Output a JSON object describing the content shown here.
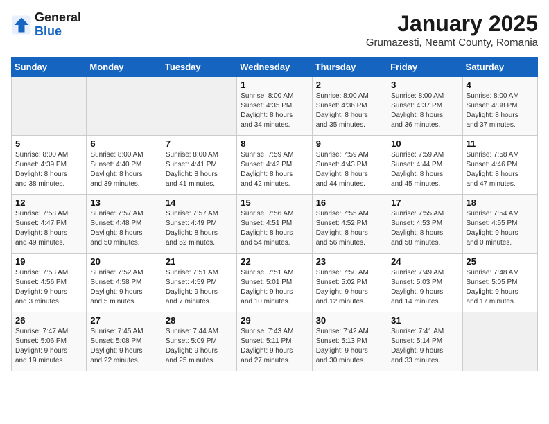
{
  "header": {
    "logo_general": "General",
    "logo_blue": "Blue",
    "month": "January 2025",
    "location": "Grumazesti, Neamt County, Romania"
  },
  "weekdays": [
    "Sunday",
    "Monday",
    "Tuesday",
    "Wednesday",
    "Thursday",
    "Friday",
    "Saturday"
  ],
  "weeks": [
    [
      {
        "day": "",
        "info": ""
      },
      {
        "day": "",
        "info": ""
      },
      {
        "day": "",
        "info": ""
      },
      {
        "day": "1",
        "info": "Sunrise: 8:00 AM\nSunset: 4:35 PM\nDaylight: 8 hours\nand 34 minutes."
      },
      {
        "day": "2",
        "info": "Sunrise: 8:00 AM\nSunset: 4:36 PM\nDaylight: 8 hours\nand 35 minutes."
      },
      {
        "day": "3",
        "info": "Sunrise: 8:00 AM\nSunset: 4:37 PM\nDaylight: 8 hours\nand 36 minutes."
      },
      {
        "day": "4",
        "info": "Sunrise: 8:00 AM\nSunset: 4:38 PM\nDaylight: 8 hours\nand 37 minutes."
      }
    ],
    [
      {
        "day": "5",
        "info": "Sunrise: 8:00 AM\nSunset: 4:39 PM\nDaylight: 8 hours\nand 38 minutes."
      },
      {
        "day": "6",
        "info": "Sunrise: 8:00 AM\nSunset: 4:40 PM\nDaylight: 8 hours\nand 39 minutes."
      },
      {
        "day": "7",
        "info": "Sunrise: 8:00 AM\nSunset: 4:41 PM\nDaylight: 8 hours\nand 41 minutes."
      },
      {
        "day": "8",
        "info": "Sunrise: 7:59 AM\nSunset: 4:42 PM\nDaylight: 8 hours\nand 42 minutes."
      },
      {
        "day": "9",
        "info": "Sunrise: 7:59 AM\nSunset: 4:43 PM\nDaylight: 8 hours\nand 44 minutes."
      },
      {
        "day": "10",
        "info": "Sunrise: 7:59 AM\nSunset: 4:44 PM\nDaylight: 8 hours\nand 45 minutes."
      },
      {
        "day": "11",
        "info": "Sunrise: 7:58 AM\nSunset: 4:46 PM\nDaylight: 8 hours\nand 47 minutes."
      }
    ],
    [
      {
        "day": "12",
        "info": "Sunrise: 7:58 AM\nSunset: 4:47 PM\nDaylight: 8 hours\nand 49 minutes."
      },
      {
        "day": "13",
        "info": "Sunrise: 7:57 AM\nSunset: 4:48 PM\nDaylight: 8 hours\nand 50 minutes."
      },
      {
        "day": "14",
        "info": "Sunrise: 7:57 AM\nSunset: 4:49 PM\nDaylight: 8 hours\nand 52 minutes."
      },
      {
        "day": "15",
        "info": "Sunrise: 7:56 AM\nSunset: 4:51 PM\nDaylight: 8 hours\nand 54 minutes."
      },
      {
        "day": "16",
        "info": "Sunrise: 7:55 AM\nSunset: 4:52 PM\nDaylight: 8 hours\nand 56 minutes."
      },
      {
        "day": "17",
        "info": "Sunrise: 7:55 AM\nSunset: 4:53 PM\nDaylight: 8 hours\nand 58 minutes."
      },
      {
        "day": "18",
        "info": "Sunrise: 7:54 AM\nSunset: 4:55 PM\nDaylight: 9 hours\nand 0 minutes."
      }
    ],
    [
      {
        "day": "19",
        "info": "Sunrise: 7:53 AM\nSunset: 4:56 PM\nDaylight: 9 hours\nand 3 minutes."
      },
      {
        "day": "20",
        "info": "Sunrise: 7:52 AM\nSunset: 4:58 PM\nDaylight: 9 hours\nand 5 minutes."
      },
      {
        "day": "21",
        "info": "Sunrise: 7:51 AM\nSunset: 4:59 PM\nDaylight: 9 hours\nand 7 minutes."
      },
      {
        "day": "22",
        "info": "Sunrise: 7:51 AM\nSunset: 5:01 PM\nDaylight: 9 hours\nand 10 minutes."
      },
      {
        "day": "23",
        "info": "Sunrise: 7:50 AM\nSunset: 5:02 PM\nDaylight: 9 hours\nand 12 minutes."
      },
      {
        "day": "24",
        "info": "Sunrise: 7:49 AM\nSunset: 5:03 PM\nDaylight: 9 hours\nand 14 minutes."
      },
      {
        "day": "25",
        "info": "Sunrise: 7:48 AM\nSunset: 5:05 PM\nDaylight: 9 hours\nand 17 minutes."
      }
    ],
    [
      {
        "day": "26",
        "info": "Sunrise: 7:47 AM\nSunset: 5:06 PM\nDaylight: 9 hours\nand 19 minutes."
      },
      {
        "day": "27",
        "info": "Sunrise: 7:45 AM\nSunset: 5:08 PM\nDaylight: 9 hours\nand 22 minutes."
      },
      {
        "day": "28",
        "info": "Sunrise: 7:44 AM\nSunset: 5:09 PM\nDaylight: 9 hours\nand 25 minutes."
      },
      {
        "day": "29",
        "info": "Sunrise: 7:43 AM\nSunset: 5:11 PM\nDaylight: 9 hours\nand 27 minutes."
      },
      {
        "day": "30",
        "info": "Sunrise: 7:42 AM\nSunset: 5:13 PM\nDaylight: 9 hours\nand 30 minutes."
      },
      {
        "day": "31",
        "info": "Sunrise: 7:41 AM\nSunset: 5:14 PM\nDaylight: 9 hours\nand 33 minutes."
      },
      {
        "day": "",
        "info": ""
      }
    ]
  ]
}
